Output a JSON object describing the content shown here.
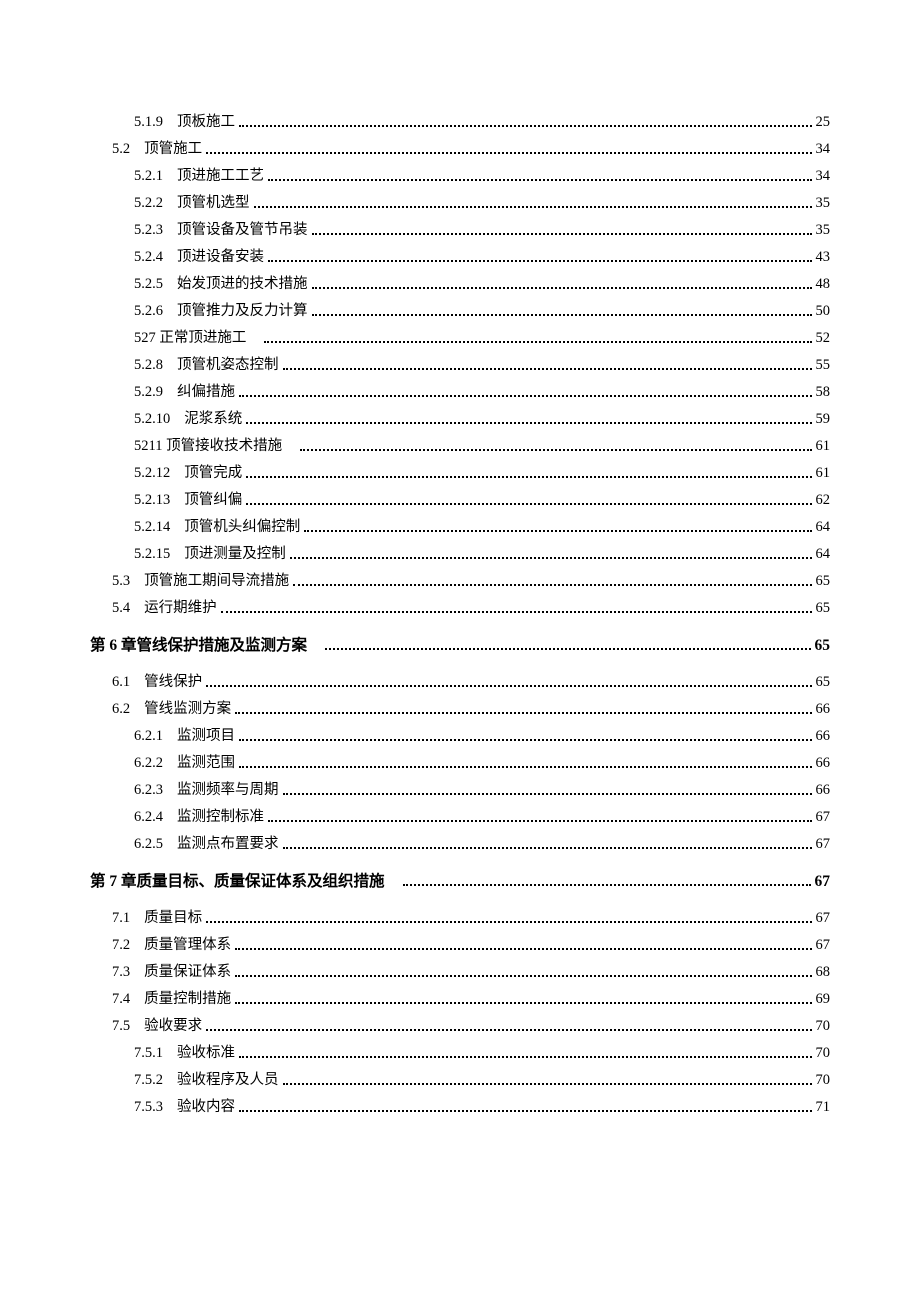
{
  "toc": [
    {
      "num": "5.1.9",
      "title": "顶板施工",
      "page": "25",
      "level": 2
    },
    {
      "num": "5.2",
      "title": "顶管施工",
      "page": "34",
      "level": 1
    },
    {
      "num": "5.2.1",
      "title": "顶进施工工艺",
      "page": "34",
      "level": 2
    },
    {
      "num": "5.2.2",
      "title": "顶管机选型",
      "page": "35",
      "level": 2
    },
    {
      "num": "5.2.3",
      "title": " 顶管设备及管节吊装",
      "page": "35",
      "level": 2
    },
    {
      "num": "5.2.4",
      "title": "顶进设备安装",
      "page": "43",
      "level": 2
    },
    {
      "num": "5.2.5",
      "title": "始发顶进的技术措施",
      "page": "48",
      "level": 2
    },
    {
      "num": "5.2.6",
      "title": "顶管推力及反力计算",
      "page": "50",
      "level": 2
    },
    {
      "num": "527 正常顶进施工",
      "title": "",
      "page": "52",
      "level": 2
    },
    {
      "num": "5.2.8",
      "title": "顶管机姿态控制",
      "page": "55",
      "level": 2
    },
    {
      "num": "5.2.9",
      "title": "纠偏措施",
      "page": "58",
      "level": 2
    },
    {
      "num": "5.2.10",
      "title": "泥浆系统",
      "page": "59",
      "level": 2
    },
    {
      "num": "5211 顶管接收技术措施",
      "title": "",
      "page": "61",
      "level": 2
    },
    {
      "num": "5.2.12",
      "title": "顶管完成",
      "page": "61",
      "level": 2
    },
    {
      "num": "5.2.13",
      "title": "顶管纠偏",
      "page": "62",
      "level": 2
    },
    {
      "num": "5.2.14",
      "title": "顶管机头纠偏控制",
      "page": "64",
      "level": 2
    },
    {
      "num": "5.2.15",
      "title": "顶进测量及控制",
      "page": "64",
      "level": 2
    },
    {
      "num": "5.3",
      "title": "顶管施工期间导流措施",
      "page": "65",
      "level": 1
    },
    {
      "num": "5.4",
      "title": "运行期维护",
      "page": "65",
      "level": 1
    },
    {
      "num": "第 6 章管线保护措施及监测方案",
      "title": "",
      "page": "65",
      "level": 0
    },
    {
      "num": "6.1",
      "title": "管线保护",
      "page": "65",
      "level": 1
    },
    {
      "num": "6.2",
      "title": "管线监测方案",
      "page": "66",
      "level": 1
    },
    {
      "num": "6.2.1",
      "title": "监测项目",
      "page": "66",
      "level": 2
    },
    {
      "num": "6.2.2",
      "title": "监测范围",
      "page": "66",
      "level": 2
    },
    {
      "num": "6.2.3",
      "title": "监测频率与周期",
      "page": "66",
      "level": 2
    },
    {
      "num": "6.2.4",
      "title": "监测控制标准",
      "page": "67",
      "level": 2
    },
    {
      "num": "6.2.5",
      "title": "监测点布置要求",
      "page": "67",
      "level": 2
    },
    {
      "num": "第 7 章质量目标、质量保证体系及组织措施",
      "title": "",
      "page": "67",
      "level": 0
    },
    {
      "num": "7.1",
      "title": "质量目标",
      "page": "67",
      "level": 1
    },
    {
      "num": "7.2",
      "title": "质量管理体系",
      "page": "67",
      "level": 1
    },
    {
      "num": "7.3",
      "title": "质量保证体系",
      "page": "68",
      "level": 1
    },
    {
      "num": "7.4",
      "title": "质量控制措施",
      "page": "69",
      "level": 1
    },
    {
      "num": "7.5",
      "title": "验收要求",
      "page": "70",
      "level": 1
    },
    {
      "num": "7.5.1",
      "title": "验收标准",
      "page": "70",
      "level": 2
    },
    {
      "num": "7.5.2",
      "title": "验收程序及人员",
      "page": "70",
      "level": 2
    },
    {
      "num": "7.5.3",
      "title": "验收内容",
      "page": "71",
      "level": 2
    }
  ]
}
